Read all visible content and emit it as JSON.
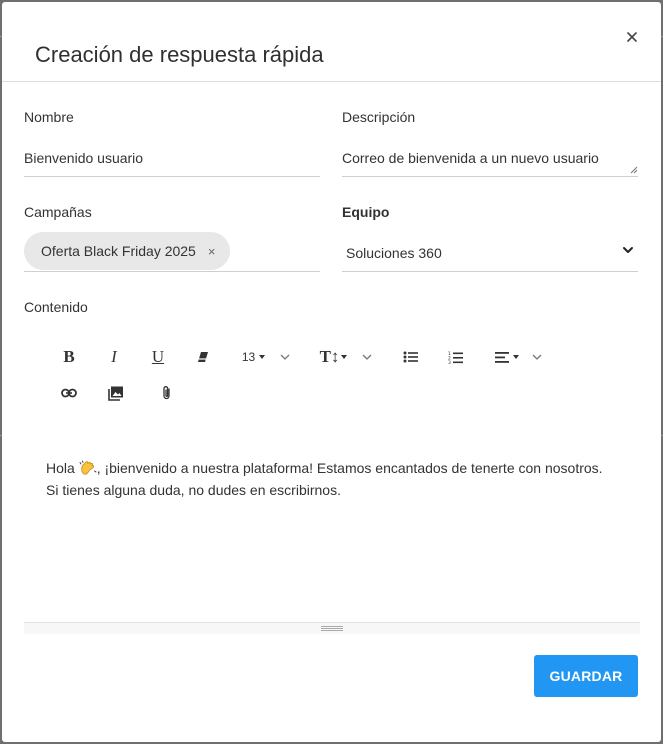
{
  "dialog": {
    "title": "Creación de respuesta rápida",
    "close_icon": "close-icon"
  },
  "form": {
    "nombre": {
      "label": "Nombre",
      "value": "Bienvenido usuario"
    },
    "descripcion": {
      "label": "Descripción",
      "value": "Correo de bienvenida a un nuevo usuario"
    },
    "campanas": {
      "label": "Campañas",
      "chips": [
        {
          "label": "Oferta Black Friday 2025",
          "remove_icon": "×"
        }
      ]
    },
    "equipo": {
      "label": "Equipo",
      "selected": "Soluciones 360"
    },
    "contenido": {
      "label": "Contenido"
    }
  },
  "editor": {
    "toolbar": {
      "bold": "B",
      "italic": "I",
      "underline": "U",
      "clear_format": "eraser-icon",
      "font_size": "13",
      "text_size_icon": "T↕",
      "bullet_list": "bullet-list-icon",
      "numbered_list": "numbered-list-icon",
      "align": "align-icon",
      "link": "link-icon",
      "image": "image-icon",
      "attach": "paperclip-icon"
    },
    "content": {
      "line1_before": "Hola ",
      "line1_emoji": "clapping-hands-emoji",
      "line1_after": ", ¡bienvenido a nuestra plataforma! Estamos encantados de tenerte con nosotros.",
      "line2": "Si tienes alguna duda, no dudes en escribirnos."
    }
  },
  "actions": {
    "save_label": "GUARDAR"
  },
  "colors": {
    "primary": "#2196f3",
    "chip_bg": "#e8e8e8",
    "divider": "#cfcfcf"
  }
}
